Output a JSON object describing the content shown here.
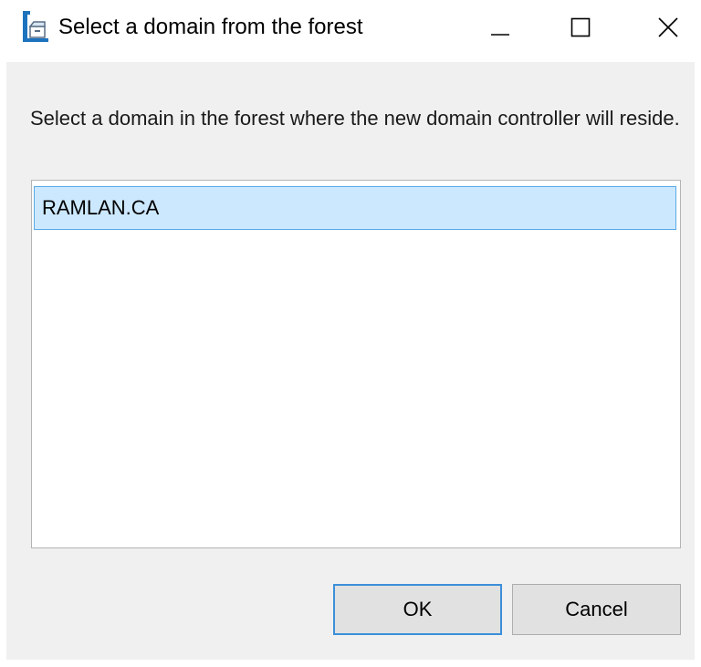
{
  "window": {
    "title": "Select a domain from the forest",
    "controls": {
      "minimize_icon": "minimize-icon",
      "maximize_icon": "maximize-icon",
      "close_icon": "close-icon"
    }
  },
  "dialog": {
    "instruction": "Select a domain in the forest where the new domain controller will reside.",
    "domains": [
      {
        "label": "RAMLAN.CA",
        "selected": true
      }
    ],
    "ok_label": "OK",
    "cancel_label": "Cancel"
  },
  "colors": {
    "background": "#f0f0f0",
    "selection_fill": "#cce8ff",
    "selection_border": "#5aa9e6",
    "default_button_border": "#3c8fd9"
  }
}
